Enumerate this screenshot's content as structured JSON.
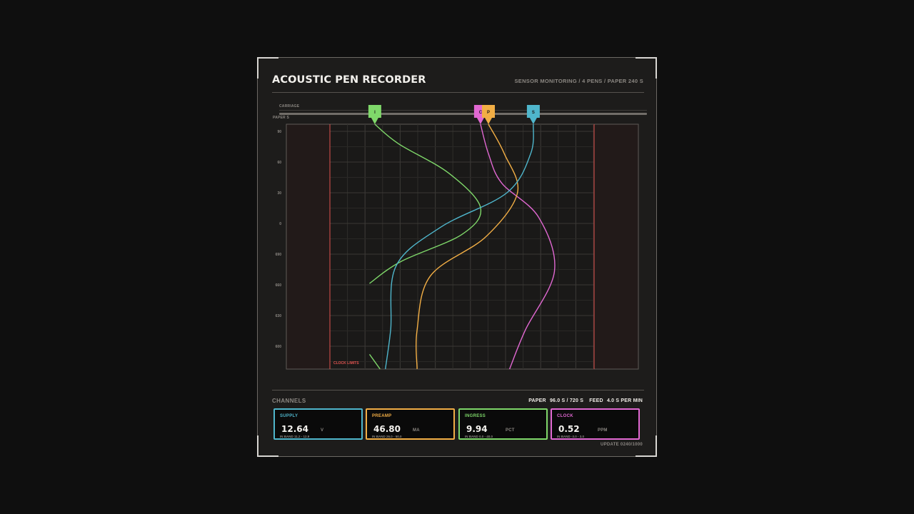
{
  "header": {
    "title": "ACOUSTIC PEN RECORDER",
    "subtitle": "SENSOR MONITORING / 4 PENS / PAPER 240 S"
  },
  "rail": {
    "carriage_label": "CARRIAGE",
    "paper_label": "PAPER S"
  },
  "chart_data": {
    "type": "line",
    "orientation": "vertical-strip",
    "y_tick_labels": [
      "90",
      "60",
      "30",
      "0",
      "690",
      "660",
      "630",
      "600"
    ],
    "clock_limits_label": "CLOCK LIMITS",
    "series": [
      {
        "name": "I",
        "color": "#7fd86a",
        "pen_position": 0.17,
        "trace": [
          [
            0.17,
            0
          ],
          [
            0.26,
            0.08
          ],
          [
            0.45,
            0.2
          ],
          [
            0.57,
            0.34
          ],
          [
            0.5,
            0.45
          ],
          [
            0.27,
            0.56
          ],
          [
            0.15,
            0.65
          ]
        ],
        "tail": [
          [
            0.15,
            0.94
          ],
          [
            0.19,
            1.0
          ]
        ]
      },
      {
        "name": "C",
        "color": "#e168d2",
        "pen_position": 0.57,
        "trace": [
          [
            0.57,
            0
          ],
          [
            0.6,
            0.12
          ],
          [
            0.65,
            0.24
          ],
          [
            0.79,
            0.38
          ],
          [
            0.85,
            0.6
          ],
          [
            0.74,
            0.84
          ],
          [
            0.68,
            1.0
          ]
        ]
      },
      {
        "name": "P",
        "color": "#f2ae45",
        "pen_position": 0.6,
        "trace": [
          [
            0.6,
            0
          ],
          [
            0.66,
            0.12
          ],
          [
            0.71,
            0.28
          ],
          [
            0.59,
            0.46
          ],
          [
            0.38,
            0.62
          ],
          [
            0.33,
            0.84
          ],
          [
            0.33,
            1.0
          ]
        ]
      },
      {
        "name": "S",
        "color": "#4fb6cc",
        "pen_position": 0.77,
        "trace": [
          [
            0.77,
            0
          ],
          [
            0.76,
            0.12
          ],
          [
            0.67,
            0.28
          ],
          [
            0.42,
            0.42
          ],
          [
            0.25,
            0.58
          ],
          [
            0.23,
            0.84
          ],
          [
            0.21,
            1.0
          ]
        ]
      }
    ]
  },
  "channels": {
    "label": "CHANNELS",
    "paper_key": "PAPER",
    "paper_value": "96.0 S / 720 S",
    "feed_key": "FEED",
    "feed_value": "4.0 S PER MIN",
    "items": [
      {
        "name": "SUPPLY",
        "value": "12.64",
        "unit": "V",
        "band": "IN BAND  11.2 - 12.9",
        "color": "#4fb6cc"
      },
      {
        "name": "PREAMP",
        "value": "46.80",
        "unit": "MA",
        "band": "IN BAND  26.0 - 50.0",
        "color": "#f2ae45"
      },
      {
        "name": "INGRESS",
        "value": "9.94",
        "unit": "PCT",
        "band": "IN BAND  0.0 - 40.0",
        "color": "#7fd86a"
      },
      {
        "name": "CLOCK",
        "value": "0.52",
        "unit": "PPM",
        "band": "IN BAND  -3.0 - 3.0",
        "color": "#e168d2"
      }
    ]
  },
  "footer": {
    "update": "UPDATE 0240/1000"
  },
  "colors": {
    "background": "#0f0f0f",
    "panel": "#1d1c1b",
    "limit": "#e0534f"
  }
}
